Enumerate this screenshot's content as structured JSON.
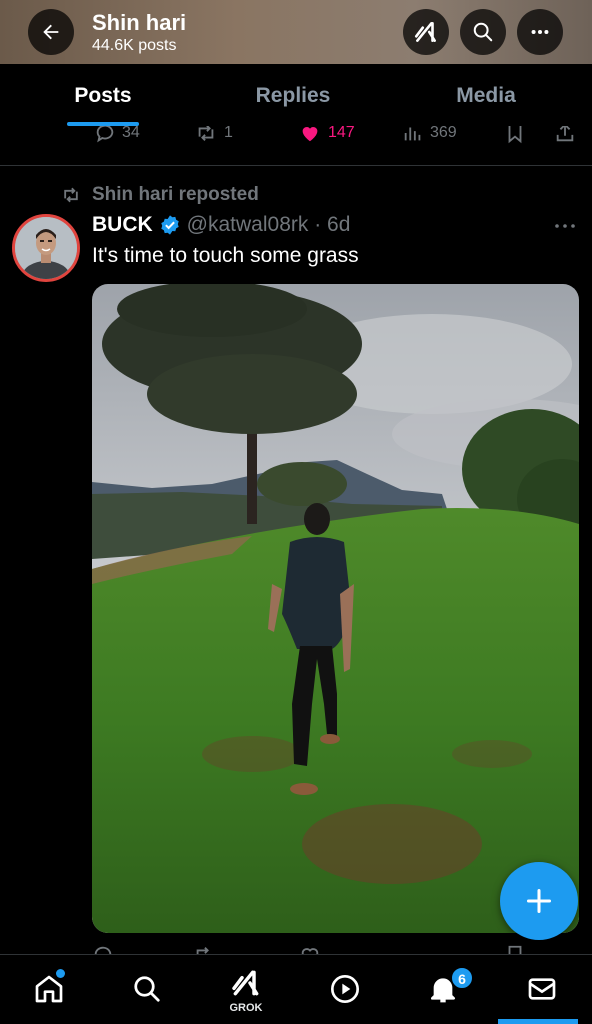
{
  "header": {
    "title": "Shin hari",
    "subtitle": "44.6K posts"
  },
  "tabs": [
    {
      "label": "Posts",
      "active": true
    },
    {
      "label": "Replies",
      "active": false
    },
    {
      "label": "Media",
      "active": false
    }
  ],
  "prev_post_actions": {
    "replies": "34",
    "reposts": "1",
    "likes": "147",
    "views": "369"
  },
  "post": {
    "repost_label": "Shin hari reposted",
    "author_name": "BUCK",
    "verified": true,
    "handle_time": "@katwal08rk · 6d",
    "text": "It's time to touch some grass"
  },
  "bottom_nav": {
    "grok_label": "GROK",
    "notification_count": "6"
  },
  "colors": {
    "accent": "#1d9bf0",
    "like": "#f91880",
    "muted": "#71767b",
    "background": "#000000"
  }
}
